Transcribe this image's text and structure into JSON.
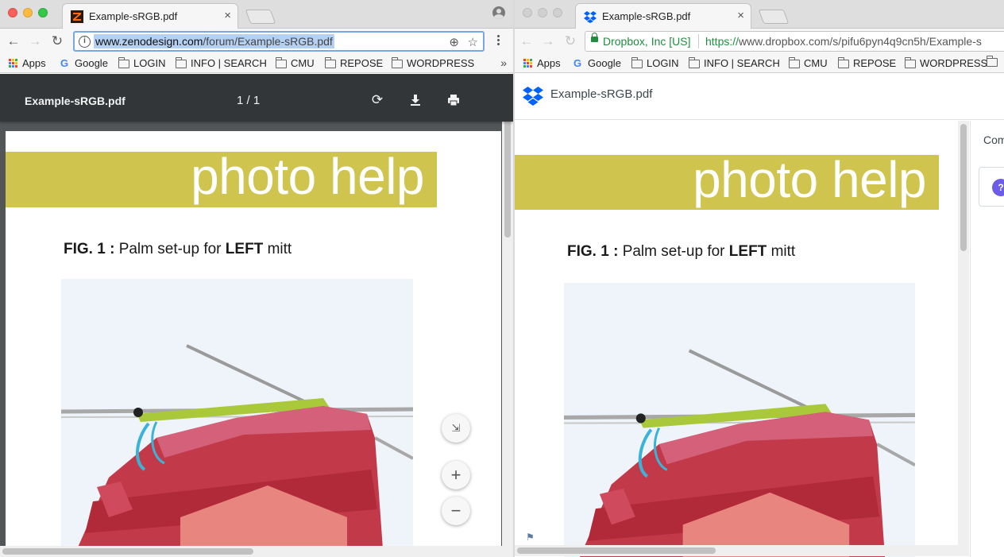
{
  "window_left": {
    "tab": {
      "title": "Example-sRGB.pdf",
      "close": "×"
    },
    "address": {
      "host": "www.zenodesign.com",
      "path": "/forum/Example-sRGB.pdf"
    },
    "pdf_toolbar": {
      "filename": "Example-sRGB.pdf",
      "page_indicator": "1 / 1"
    },
    "zoom_controls": {
      "fit": "⇲",
      "zoom_in": "+",
      "zoom_out": "−"
    }
  },
  "window_right": {
    "tab": {
      "title": "Example-sRGB.pdf",
      "close": "×"
    },
    "address": {
      "secure_label": "Dropbox, Inc [US]",
      "scheme": "https://",
      "rest": "www.dropbox.com/s/pifu6pyn4q9cn5h/Example-s"
    },
    "dropbox_header": {
      "filename": "Example-sRGB.pdf"
    },
    "sidebar": {
      "label": "Com",
      "help": "?"
    }
  },
  "bookmarks": [
    {
      "label": "Apps",
      "icon": "apps-grid-icon"
    },
    {
      "label": "Google",
      "icon": "google-icon"
    },
    {
      "label": "LOGIN",
      "icon": "folder-icon"
    },
    {
      "label": "INFO | SEARCH",
      "icon": "folder-icon"
    },
    {
      "label": "CMU",
      "icon": "folder-icon"
    },
    {
      "label": "REPOSE",
      "icon": "folder-icon"
    },
    {
      "label": "WORDPRESS",
      "icon": "folder-icon"
    }
  ],
  "bookmarks_overflow": "»",
  "document": {
    "banner_title": "photo help",
    "caption_prefix": "FIG. 1 :",
    "caption_middle": "Palm set-up for",
    "caption_bold": "LEFT",
    "caption_suffix": "mitt"
  },
  "colors": {
    "banner": "#cfc54e",
    "pdf_toolbar": "#323639",
    "pdf_background": "#525659",
    "secure_green": "#1e8e3e",
    "dropbox_blue": "#0061fe"
  }
}
